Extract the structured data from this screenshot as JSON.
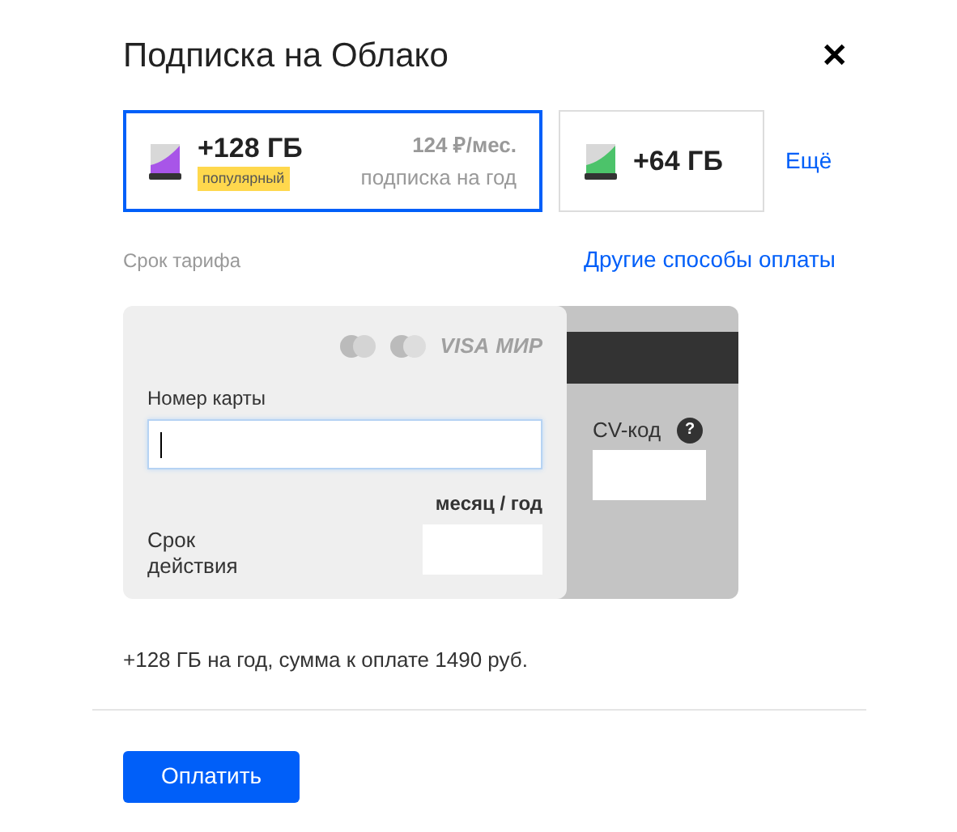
{
  "dialog": {
    "title": "Подписка на Облако",
    "close": "✕"
  },
  "plans": [
    {
      "size": "+128 ГБ",
      "badge": "популярный",
      "price": "124 ₽/мес.",
      "period": "подписка на год",
      "color": "#a855e8",
      "selected": true
    },
    {
      "size": "+64 ГБ",
      "color": "#4cc36a",
      "selected": false
    }
  ],
  "more_link": "Ещё",
  "term_label": "Срок тарифа",
  "other_payment_link": "Другие способы оплаты",
  "card_form": {
    "brands": [
      "VISA",
      "МИР"
    ],
    "card_number_label": "Номер карты",
    "expiry_label": "Срок действия",
    "expiry_hint": "месяц / год",
    "cvv_label": "CV-код",
    "cvv_help": "?"
  },
  "summary": "+128 ГБ на год, сумма к оплате 1490 руб.",
  "pay_button": "Оплатить"
}
